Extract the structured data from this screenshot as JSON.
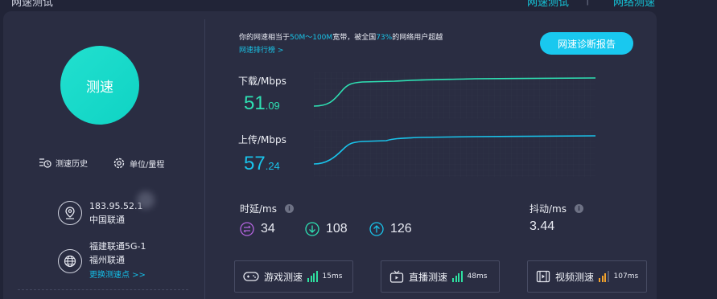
{
  "top_bar": {
    "left_text": "网速测试",
    "right_text_1": "网速测试",
    "separator": "|",
    "right_text_2": "网络测速"
  },
  "left": {
    "speed_button": "测速",
    "history_label": "测速历史",
    "unit_label": "单位/量程",
    "ip": "183.95.52.1",
    "isp": "中国联通",
    "node_name": "福建联通5G-1",
    "node_city": "福州联通",
    "change_node_link": "更换测速点 >>"
  },
  "summary": {
    "prefix": "你的网速相当于",
    "bandwidth": "50M～100M",
    "middle": "宽带，被全国",
    "percent": "73%",
    "suffix": "的网络用户超越",
    "rank_link": "网速排行榜 >",
    "report_button": "网速诊断报告"
  },
  "download": {
    "label": "下载/Mbps",
    "int": "51",
    "dec": ".09",
    "color": "#2ee0b3"
  },
  "upload": {
    "label": "上传/Mbps",
    "int": "57",
    "dec": ".24",
    "color": "#19c3ea"
  },
  "latency": {
    "title": "时延/ms",
    "ping": "34",
    "down": "108",
    "up": "126",
    "colors": {
      "ping": "#b565e0",
      "down": "#2ee0b3",
      "up": "#19c3ea"
    }
  },
  "jitter": {
    "title": "抖动/ms",
    "value": "3.44"
  },
  "tests": [
    {
      "label": "游戏测速",
      "ms": "15ms",
      "bar_color": "#2ee0a0"
    },
    {
      "label": "直播测速",
      "ms": "48ms",
      "bar_color": "#2ee0a0"
    },
    {
      "label": "视频测速",
      "ms": "107ms",
      "bar_color": "#f2a22c"
    }
  ]
}
